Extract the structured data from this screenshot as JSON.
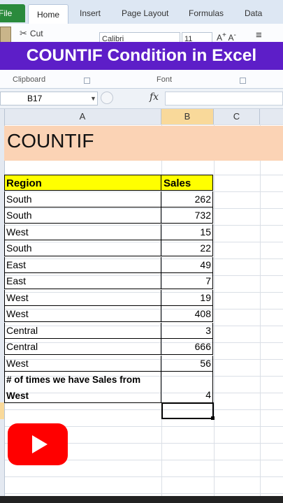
{
  "ribbon": {
    "tabs": [
      "File",
      "Home",
      "Insert",
      "Page Layout",
      "Formulas",
      "Data"
    ],
    "cut_label": "Cut",
    "font_name": "Calibri",
    "font_size": "11",
    "clipboard_label": "Clipboard",
    "font_label": "Font"
  },
  "banner": {
    "title": "COUNTIF Condition in Excel"
  },
  "formula_bar": {
    "name_box": "B17",
    "fx": "fx",
    "formula": ""
  },
  "columns": [
    "A",
    "B",
    "C"
  ],
  "sheet": {
    "title": "COUNTIF",
    "headers": {
      "region": "Region",
      "sales": "Sales"
    },
    "rows": [
      {
        "region": "South",
        "sales": "262"
      },
      {
        "region": "South",
        "sales": "732"
      },
      {
        "region": "West",
        "sales": "15"
      },
      {
        "region": "South",
        "sales": "22"
      },
      {
        "region": "East",
        "sales": "49"
      },
      {
        "region": "East",
        "sales": "7"
      },
      {
        "region": "West",
        "sales": "19"
      },
      {
        "region": "West",
        "sales": "408"
      },
      {
        "region": "Central",
        "sales": "3"
      },
      {
        "region": "Central",
        "sales": "666"
      },
      {
        "region": "West",
        "sales": "56"
      }
    ],
    "summary_label_line1": "# of times we have Sales from",
    "summary_label_line2": "West",
    "summary_value": "4"
  },
  "colors": {
    "banner": "#5d1ec8",
    "title_fill": "#fbd3b5",
    "header_fill": "#ffff00",
    "file_tab": "#2a8a3c",
    "youtube": "#ff0000"
  },
  "overlay": {
    "logo_icon": "youtube-logo-icon"
  }
}
